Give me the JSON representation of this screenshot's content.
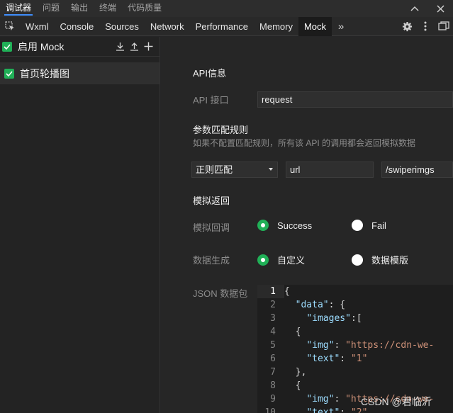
{
  "top_tabs": [
    "调试器",
    "问题",
    "输出",
    "终端",
    "代码质量"
  ],
  "top_active": 0,
  "dev_tabs": [
    "Wxml",
    "Console",
    "Sources",
    "Network",
    "Performance",
    "Memory",
    "Mock"
  ],
  "dev_active": 6,
  "more_glyph": "»",
  "left": {
    "enable_label": "启用 Mock",
    "rules": [
      {
        "label": "首页轮播图",
        "checked": true
      }
    ]
  },
  "api_section": {
    "title": "API信息",
    "api_label": "API 接口",
    "api_value": "request"
  },
  "match_section": {
    "title": "参数匹配规则",
    "hint": "如果不配置匹配规则，所有该 API 的调用都会返回模拟数据",
    "mode_value": "正则匹配",
    "key_value": "url",
    "pattern_value": "/swiperimgs"
  },
  "return_section": {
    "title": "模拟返回",
    "callback_label": "模拟回调",
    "callback_options": [
      "Success",
      "Fail"
    ],
    "callback_selected": 0,
    "gen_label": "数据生成",
    "gen_options": [
      "自定义",
      "数据模版"
    ],
    "gen_selected": 0,
    "json_label": "JSON 数据包"
  },
  "editor": {
    "current_line": 1,
    "lines": [
      "{",
      "  \"data\": {",
      "    \"images\":[",
      "  {",
      "    \"img\": \"https://cdn-we-",
      "    \"text\": \"1\"",
      "  },",
      "  {",
      "    \"img\": \"https://cdn-we-",
      "    \"text\": \"2\""
    ]
  },
  "watermark": "CSDN @君临沂"
}
